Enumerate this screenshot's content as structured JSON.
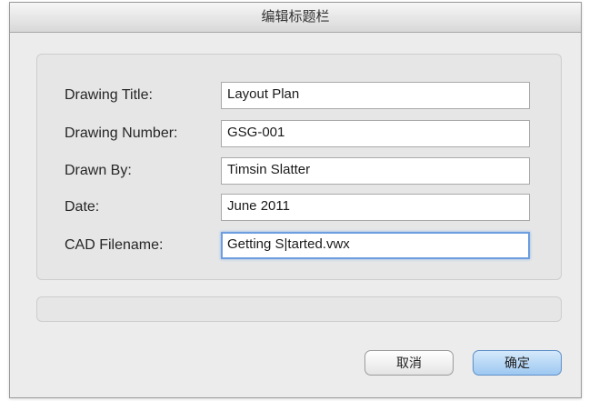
{
  "dialog": {
    "title": "编辑标题栏"
  },
  "form": {
    "fields": [
      {
        "label": "Drawing Title:",
        "value": "Layout Plan"
      },
      {
        "label": "Drawing Number:",
        "value": "GSG-001"
      },
      {
        "label": "Drawn By:",
        "value": "Timsin Slatter"
      },
      {
        "label": "Date:",
        "value": "June 2011"
      },
      {
        "label": "CAD Filename:",
        "value": "Getting S|tarted.vwx"
      }
    ]
  },
  "buttons": {
    "cancel_label": "取消",
    "ok_label": "确定"
  },
  "colors": {
    "focus_ring": "#6e9ee0",
    "default_button": "#9dc8f1"
  }
}
